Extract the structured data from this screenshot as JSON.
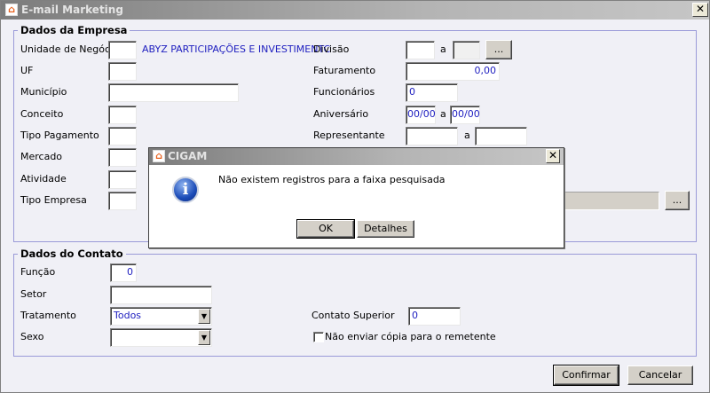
{
  "window": {
    "title": "E-mail Marketing",
    "close": "✕"
  },
  "empresa": {
    "legend": "Dados da Empresa",
    "unidade_label": "Unidade de Negócio",
    "unidade_value": "",
    "unidade_name": "ABYZ PARTICIPAÇÕES E INVESTIMENTC",
    "uf_label": "UF",
    "municipio_label": "Município",
    "conceito_label": "Conceito",
    "tipo_pagamento_label": "Tipo Pagamento",
    "mercado_label": "Mercado",
    "atividade_label": "Atividade",
    "tipo_empresa_label": "Tipo Empresa",
    "divisao_label": "Divisão",
    "a": "a",
    "ellipsis": "...",
    "faturamento_label": "Faturamento",
    "faturamento_value": "0,00",
    "funcionarios_label": "Funcionários",
    "funcionarios_value": "0",
    "aniversario_label": "Aniversário",
    "aniversario_from": "00/00",
    "aniversario_to": "00/00",
    "representante_label": "Representante"
  },
  "dialog": {
    "title": "CIGAM",
    "message": "Não existem registros para a faixa pesquisada",
    "ok": "OK",
    "details": "Detalhes",
    "close": "✕"
  },
  "contato": {
    "legend": "Dados do Contato",
    "funcao_label": "Função",
    "funcao_value": "0",
    "setor_label": "Setor",
    "tratamento_label": "Tratamento",
    "tratamento_value": "Todos",
    "sexo_label": "Sexo",
    "sexo_value": "",
    "contato_superior_label": "Contato Superior",
    "contato_superior_value": "0",
    "nao_enviar_label": "Não enviar cópia para o remetente",
    "nao_enviar_checked": false
  },
  "footer": {
    "confirm": "Confirmar",
    "cancel": "Cancelar"
  }
}
